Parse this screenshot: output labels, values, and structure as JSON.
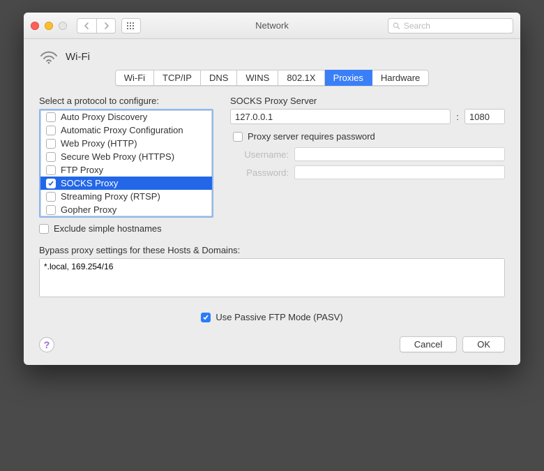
{
  "window": {
    "title": "Network"
  },
  "search": {
    "placeholder": "Search"
  },
  "service": {
    "name": "Wi-Fi"
  },
  "tabs": [
    "Wi-Fi",
    "TCP/IP",
    "DNS",
    "WINS",
    "802.1X",
    "Proxies",
    "Hardware"
  ],
  "activeTab": "Proxies",
  "left": {
    "select_label": "Select a protocol to configure:",
    "protocols": [
      {
        "label": "Auto Proxy Discovery",
        "checked": false
      },
      {
        "label": "Automatic Proxy Configuration",
        "checked": false
      },
      {
        "label": "Web Proxy (HTTP)",
        "checked": false
      },
      {
        "label": "Secure Web Proxy (HTTPS)",
        "checked": false
      },
      {
        "label": "FTP Proxy",
        "checked": false
      },
      {
        "label": "SOCKS Proxy",
        "checked": true,
        "selected": true
      },
      {
        "label": "Streaming Proxy (RTSP)",
        "checked": false
      },
      {
        "label": "Gopher Proxy",
        "checked": false
      }
    ],
    "exclude_label": "Exclude simple hostnames",
    "exclude_checked": false
  },
  "right": {
    "server_label": "SOCKS Proxy Server",
    "host": "127.0.0.1",
    "port": "1080",
    "auth_label": "Proxy server requires password",
    "auth_checked": false,
    "username_label": "Username:",
    "password_label": "Password:",
    "username": "",
    "password": ""
  },
  "bypass": {
    "label": "Bypass proxy settings for these Hosts & Domains:",
    "value": "*.local, 169.254/16"
  },
  "pasv": {
    "checked": true,
    "label": "Use Passive FTP Mode (PASV)"
  },
  "buttons": {
    "cancel": "Cancel",
    "ok": "OK"
  }
}
